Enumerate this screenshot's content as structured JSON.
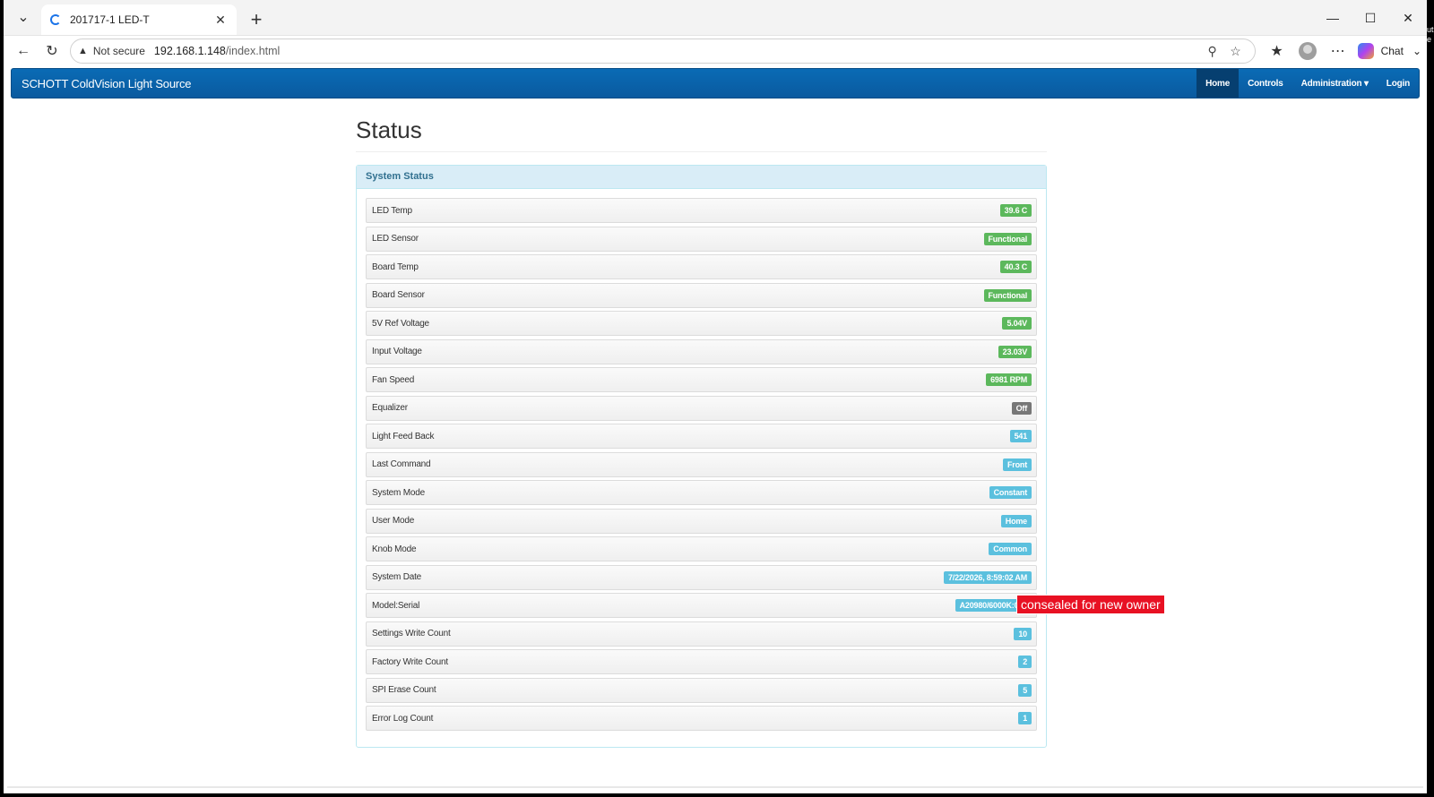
{
  "browser": {
    "tab_title": "201717-1 LED-T",
    "url_security": "Not secure",
    "url_host": "192.168.1.148",
    "url_path": "/index.html",
    "chat_label": "Chat",
    "edge_label": "ut e"
  },
  "navbar": {
    "brand": "SCHOTT ColdVision Light Source",
    "links": [
      "Home",
      "Controls",
      "Administration ▾",
      "Login"
    ]
  },
  "page": {
    "title": "Status",
    "panel_title": "System Status"
  },
  "status_rows": [
    {
      "label": "LED Temp",
      "value": "39.6 C",
      "color": "green"
    },
    {
      "label": "LED Sensor",
      "value": "Functional",
      "color": "green"
    },
    {
      "label": "Board Temp",
      "value": "40.3 C",
      "color": "green"
    },
    {
      "label": "Board Sensor",
      "value": "Functional",
      "color": "green"
    },
    {
      "label": "5V Ref Voltage",
      "value": "5.04V",
      "color": "green"
    },
    {
      "label": "Input Voltage",
      "value": "23.03V",
      "color": "green"
    },
    {
      "label": "Fan Speed",
      "value": "6981 RPM",
      "color": "green"
    },
    {
      "label": "Equalizer",
      "value": "Off",
      "color": "gray"
    },
    {
      "label": "Light Feed Back",
      "value": "541",
      "color": "blue"
    },
    {
      "label": "Last Command",
      "value": "Front",
      "color": "blue"
    },
    {
      "label": "System Mode",
      "value": "Constant",
      "color": "blue"
    },
    {
      "label": "User Mode",
      "value": "Home",
      "color": "blue"
    },
    {
      "label": "Knob Mode",
      "value": "Common",
      "color": "blue"
    },
    {
      "label": "System Date",
      "value": "7/22/2026, 8:59:02 AM",
      "color": "blue"
    },
    {
      "label": "Model:Serial",
      "value": "A20980/6000K:000",
      "color": "blue"
    },
    {
      "label": "Settings Write Count",
      "value": "10",
      "color": "blue"
    },
    {
      "label": "Factory Write Count",
      "value": "2",
      "color": "blue"
    },
    {
      "label": "SPI Erase Count",
      "value": "5",
      "color": "blue"
    },
    {
      "label": "Error Log Count",
      "value": "1",
      "color": "blue"
    }
  ],
  "redaction": "consealed for new owner",
  "colors": {
    "green": "#5cb85c",
    "gray": "#777777",
    "blue": "#5bc0de",
    "navbar": "#0a5a9f"
  }
}
